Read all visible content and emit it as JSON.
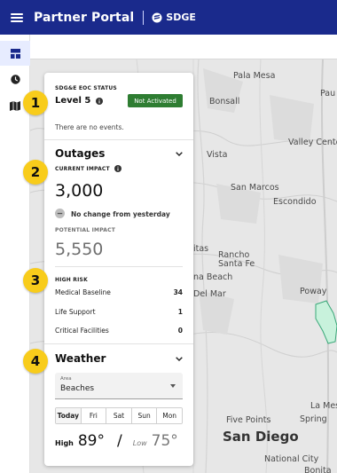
{
  "header": {
    "title": "Partner Portal",
    "brand": "SDGE"
  },
  "colors": {
    "header_bg": "#1a2a8c",
    "status_green": "#2e7d32",
    "callout_yellow": "#f8cc1b",
    "nav_active": "#1a2a8c"
  },
  "rail": {
    "items": [
      {
        "icon": "dashboard-icon",
        "active": true
      },
      {
        "icon": "clock-icon",
        "active": false
      },
      {
        "icon": "map-icon",
        "active": false
      }
    ]
  },
  "callouts": [
    "1",
    "2",
    "3",
    "4"
  ],
  "eoc": {
    "label": "SDG&E EOC STATUS",
    "level": "Level 5",
    "status": "Not Activated",
    "events_text": "There are no events."
  },
  "outages": {
    "title": "Outages",
    "current_label": "CURRENT IMPACT",
    "current_value": "3,000",
    "change_text": "No change from yesterday",
    "potential_label": "POTENTIAL IMPACT",
    "potential_value": "5,550"
  },
  "high_risk": {
    "label": "HIGH RISK",
    "rows": [
      {
        "name": "Medical Baseline",
        "value": "34"
      },
      {
        "name": "Life Support",
        "value": "1"
      },
      {
        "name": "Critical Facilities",
        "value": "0"
      }
    ]
  },
  "weather": {
    "title": "Weather",
    "area_caption": "Area",
    "area_value": "Beaches",
    "days": [
      "Today",
      "Fri",
      "Sat",
      "Sun",
      "Mon"
    ],
    "selected_day": "Today",
    "high_label": "High",
    "high_value": "89°",
    "slash": "/",
    "low_label": "Low",
    "low_value": "75°"
  },
  "map_labels": {
    "pala_mesa": "Pala Mesa",
    "bonsall": "Bonsall",
    "pau": "Pau",
    "valley_center": "Valley Cente",
    "vista": "Vista",
    "san_marcos": "San Marcos",
    "escondido": "Escondido",
    "itas": "itas",
    "rancho_santa_fe": "Rancho\nSanta Fe",
    "ana_beach": "na Beach",
    "del_mar": "Del Mar",
    "poway": "Poway",
    "la_mesa": "La Mesa",
    "five_points": "Five Points",
    "spring": "Spring",
    "san_diego": "San Diego",
    "national_city": "National City",
    "bonita": "Bonita"
  }
}
